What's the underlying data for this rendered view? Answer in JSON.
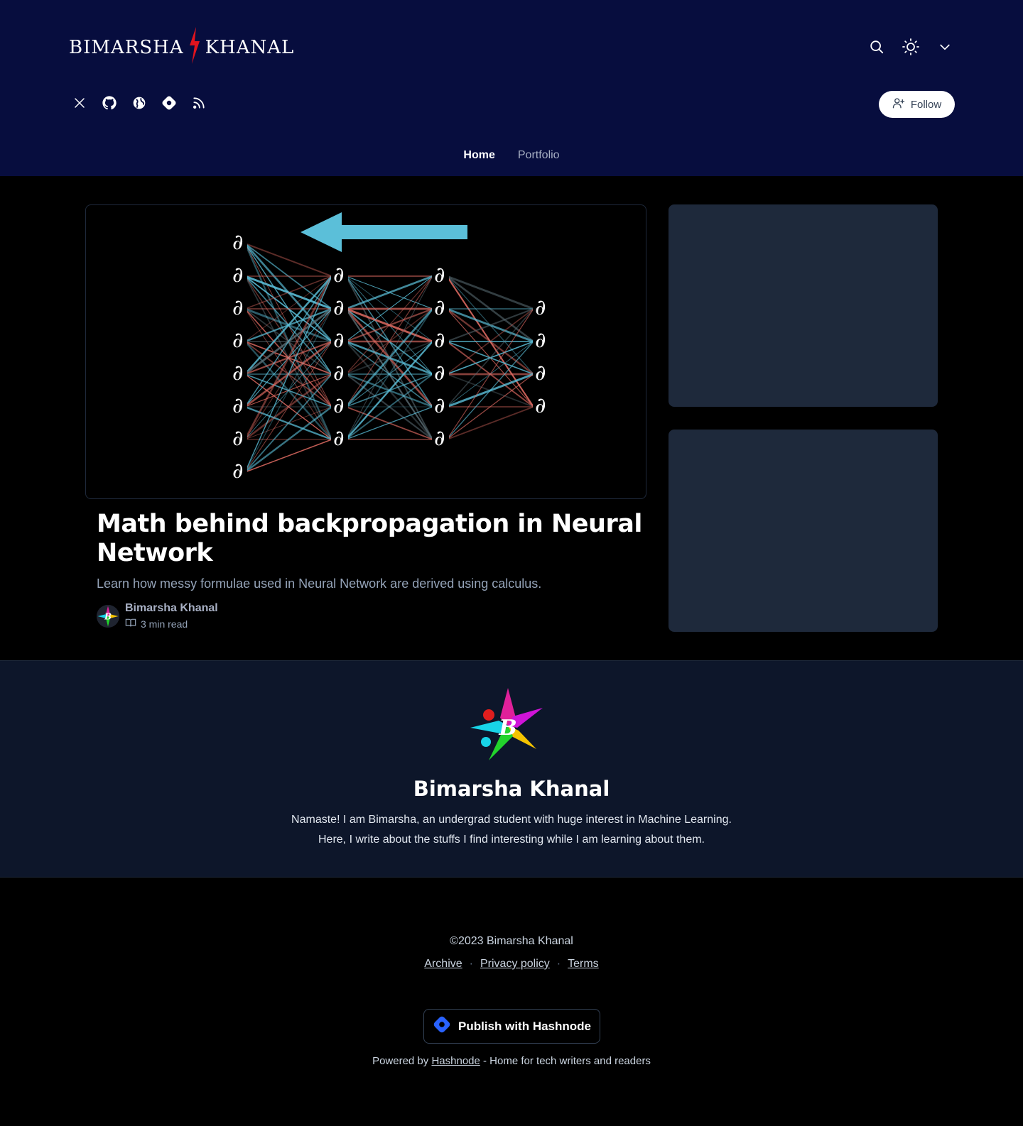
{
  "header": {
    "logo_left": "BIMARSHA",
    "logo_right": "KHANAL",
    "follow_label": "Follow",
    "icons": [
      "search-icon",
      "sun-icon",
      "chevron-down-icon"
    ],
    "social_icons": [
      "x-icon",
      "github-icon",
      "globe-icon",
      "hashnode-icon",
      "rss-icon"
    ]
  },
  "nav": {
    "items": [
      {
        "label": "Home"
      },
      {
        "label": "Portfolio"
      }
    ]
  },
  "post": {
    "title": "Math behind backpropagation in Neural Network",
    "subtitle": "Learn how messy formulae used in Neural Network are derived using calculus.",
    "author": "Bimarsha Khanal",
    "read_time": "3 min read",
    "image_glyph": "∂"
  },
  "about": {
    "name": "Bimarsha Khanal",
    "bio_line1": "Namaste! I am Bimarsha, an undergrad student with huge interest in Machine Learning.",
    "bio_line2": "Here, I write about the stuffs I find interesting while I am learning about them.",
    "avatar_letter": "B"
  },
  "footer": {
    "copyright": "©2023 Bimarsha Khanal",
    "links": [
      "Archive",
      "Privacy policy",
      "Terms"
    ],
    "publish_label": "Publish with Hashnode",
    "powered_prefix": "Powered by",
    "powered_link": "Hashnode",
    "powered_suffix": "- Home for tech writers and readers"
  },
  "colors": {
    "header_bg": "#070d3e",
    "accent_red": "#e0141e",
    "arrow_blue": "#5bbfd9",
    "edge_red": "#e06b62",
    "hashnode_blue": "#2962ff"
  }
}
